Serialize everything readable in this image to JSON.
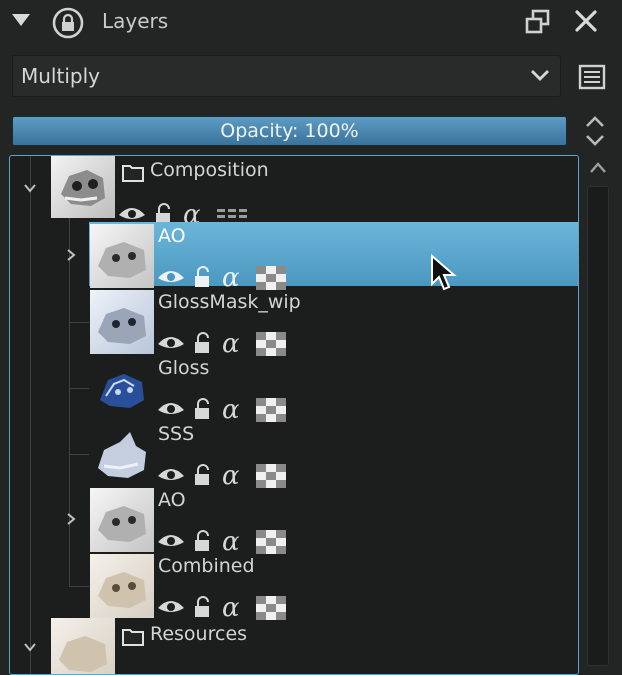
{
  "panel": {
    "title": "Layers"
  },
  "blend_mode": {
    "value": "Multiply"
  },
  "opacity": {
    "label": "Opacity:  100%",
    "value_percent": 100
  },
  "layers": [
    {
      "name": "Composition",
      "type": "group",
      "expanded": true,
      "selected": false
    },
    {
      "name": "AO",
      "type": "paint",
      "expandable": true,
      "selected": true
    },
    {
      "name": "GlossMask_wip",
      "type": "paint",
      "selected": false
    },
    {
      "name": "Gloss",
      "type": "paint",
      "selected": false
    },
    {
      "name": "SSS",
      "type": "paint",
      "selected": false
    },
    {
      "name": "AO",
      "type": "paint",
      "expandable": true,
      "selected": false
    },
    {
      "name": "Combined",
      "type": "paint",
      "selected": false
    },
    {
      "name": "Resources",
      "type": "group",
      "expanded": true,
      "selected": false
    }
  ],
  "colors": {
    "selection": "#5aaad2",
    "accent_border": "#5aa8c8",
    "background": "#232525"
  }
}
